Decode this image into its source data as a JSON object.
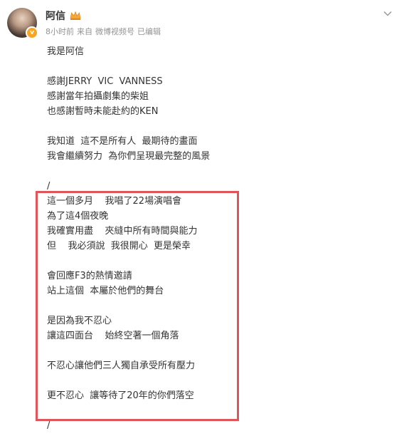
{
  "header": {
    "username": "阿信",
    "time": "8小时前",
    "source_prefix": "来自",
    "source": "微博视频号",
    "edited": "已编辑"
  },
  "body": {
    "p1": [
      "我是阿信"
    ],
    "p2": [
      "感謝JERRY  VIC  VANNESS",
      "感謝當年拍攝劇集的柴姐",
      "也感謝暫時未能赴約的KEN"
    ],
    "p3": [
      "我知道  這不是所有人  最期待的畫面",
      "我會繼續努力  為你們呈現最完整的風景"
    ],
    "divider1": "/",
    "p4": [
      "這一個多月    我唱了22場演唱會",
      "為了這4個夜晚",
      "我確實用盡    夾縫中所有時間與能力",
      "但    我必須說  我很開心  更是榮幸"
    ],
    "p5": [
      "會回應F3的熱情邀請",
      "站上這個  本屬於他們的舞台"
    ],
    "p6": [
      "是因為我不忍心",
      "讓這四面台    始終空著一個角落"
    ],
    "p7": [
      "不忍心讓他們三人獨自承受所有壓力"
    ],
    "p8": [
      "更不忍心  讓等待了20年的你們落空"
    ],
    "divider2": "/"
  },
  "colors": {
    "highlight_border": "#e0555a",
    "meta_text": "#939393",
    "body_text": "#333333"
  }
}
